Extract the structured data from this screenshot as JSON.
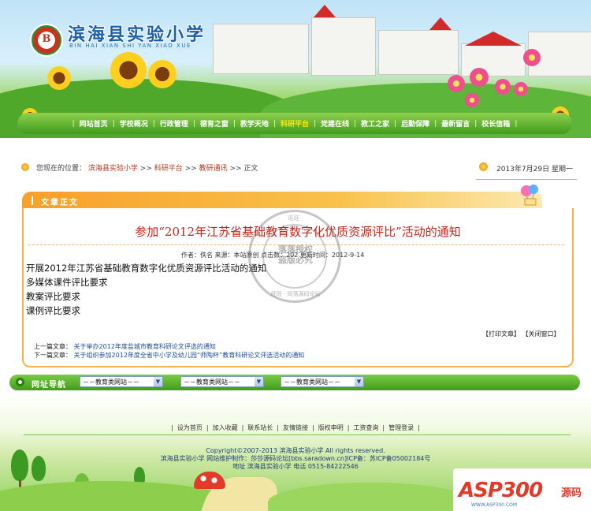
{
  "header": {
    "school_name": "滨海县实验小学",
    "school_pinyin": "BIN HAI XIAN SHI YAN XIAO XUE",
    "logo_letter": "B"
  },
  "nav": {
    "items": [
      {
        "label": "网站首页"
      },
      {
        "label": "学校概况"
      },
      {
        "label": "行政管理"
      },
      {
        "label": "德育之窗"
      },
      {
        "label": "教学天地"
      },
      {
        "label": "科研平台",
        "active": true
      },
      {
        "label": "党建在线"
      },
      {
        "label": "教工之家"
      },
      {
        "label": "后勤保障"
      },
      {
        "label": "最新留言"
      },
      {
        "label": "校长信箱"
      }
    ]
  },
  "breadcrumb": {
    "prefix": "您现在的位置：",
    "items": [
      "滨海县实验小学",
      "科研平台",
      "教研通讯"
    ],
    "separator": ">>",
    "current": "正文",
    "date": "2013年7月29日 星期一"
  },
  "article": {
    "tab_label": "文章正文",
    "title": "参加“2012年江苏省基础教育数字化优质资源评比”活动的通知",
    "meta": "作者：佚名 来源：本站原创 点击数：202 更新时间：2012-9-14",
    "body_lines": [
      "开展2012年江苏省基础教育数字化优质资源评比活动的通知",
      "多媒体课件评比要求",
      "教案评比要求",
      "课例评比要求"
    ],
    "tools": {
      "print": "【打印文章】",
      "close": "【关闭窗口】"
    },
    "prev_label": "上一篇文章：",
    "prev_title": "关于举办2012年度盐城市教育科研论文评选的通知",
    "next_label": "下一篇文章：",
    "next_title": "关于组织参加2012年度全省中小学及幼儿园“师陶杯”教育科研论文评选活动的通知"
  },
  "stamp": {
    "line1": "落落授权",
    "line2": "盗版必究",
    "top": "旺旺",
    "bottom": "旺旺 · 同落源码论坛"
  },
  "links_nav": {
    "label": "网址导航",
    "selects": [
      "－－教育类网站－－",
      "－－教育类网站－－",
      "－－教育类网站－－"
    ]
  },
  "footer": {
    "links": [
      "设为首页",
      "加入收藏",
      "联系站长",
      "友情链接",
      "版权申明",
      "工资查询",
      "管理登录"
    ],
    "copyright": "Copyright©2007-2013 滨海县实验小学  All rights reserved.",
    "maintenance": "滨海县实验小学 网站维护制作：莎莎源码论坛[bbs.saradown.cn]ICP备：苏ICP备05002184号",
    "address": "地址 滨海县实验小学 电话 0515-84222546"
  },
  "watermark": {
    "brand": "ASP300",
    "suffix": "源码",
    "url": "WWW.ASP300.COM"
  },
  "colors": {
    "nav_green": "#3f9c1c",
    "title_red": "#c8241a",
    "tab_orange": "#f7a02a",
    "school_blue": "#1c5fa8"
  }
}
